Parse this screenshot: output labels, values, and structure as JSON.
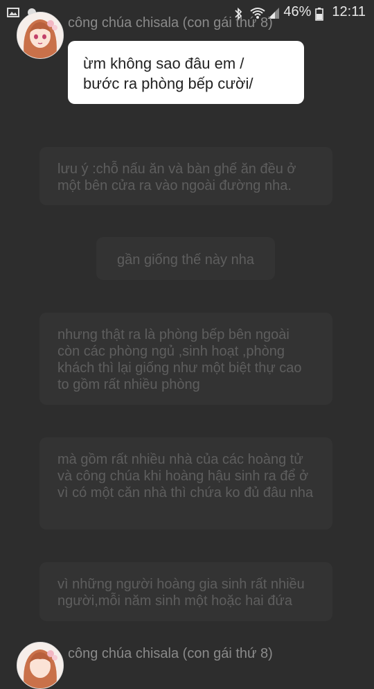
{
  "status_bar": {
    "battery": "46%",
    "time": "12:11",
    "icons": [
      "image-icon",
      "notification-dot-icon",
      "bluetooth-icon",
      "wifi-icon",
      "signal-icon",
      "battery-icon"
    ]
  },
  "messages": {
    "sender_top": "công chúa chisala (con gái thứ 8)",
    "reply": "ừm không sao đâu em /\nbước ra phòng bếp cười/",
    "note1": "lưu ý :chỗ nấu ăn và bàn ghế ăn đều ở một bên cửa ra vào ngoài đường nha.",
    "note2": "gần giống thế này nha",
    "note3": "nhưng thật ra là phòng bếp bên ngoài còn các phòng ngủ ,sinh hoạt ,phòng khách thì lại giống như một biệt thự cao to gồm rất nhiều phòng",
    "note4": "mà gồm rất nhiều nhà  của các hoàng tử và công chúa khi hoàng hậu sinh ra để ở vì có một căn nhà thì chứa ko đủ đâu nha",
    "note5": "vì những người hoàng gia sinh rất nhiều người,mỗi năm sinh một hoặc hai đứa",
    "sender_bottom": "công chúa chisala (con gái thứ 8)"
  },
  "colors": {
    "background": "#2d2d2d",
    "bubble_white": "#ffffff",
    "bubble_dark": "#333333",
    "faded_text": "#5e5e5e"
  }
}
